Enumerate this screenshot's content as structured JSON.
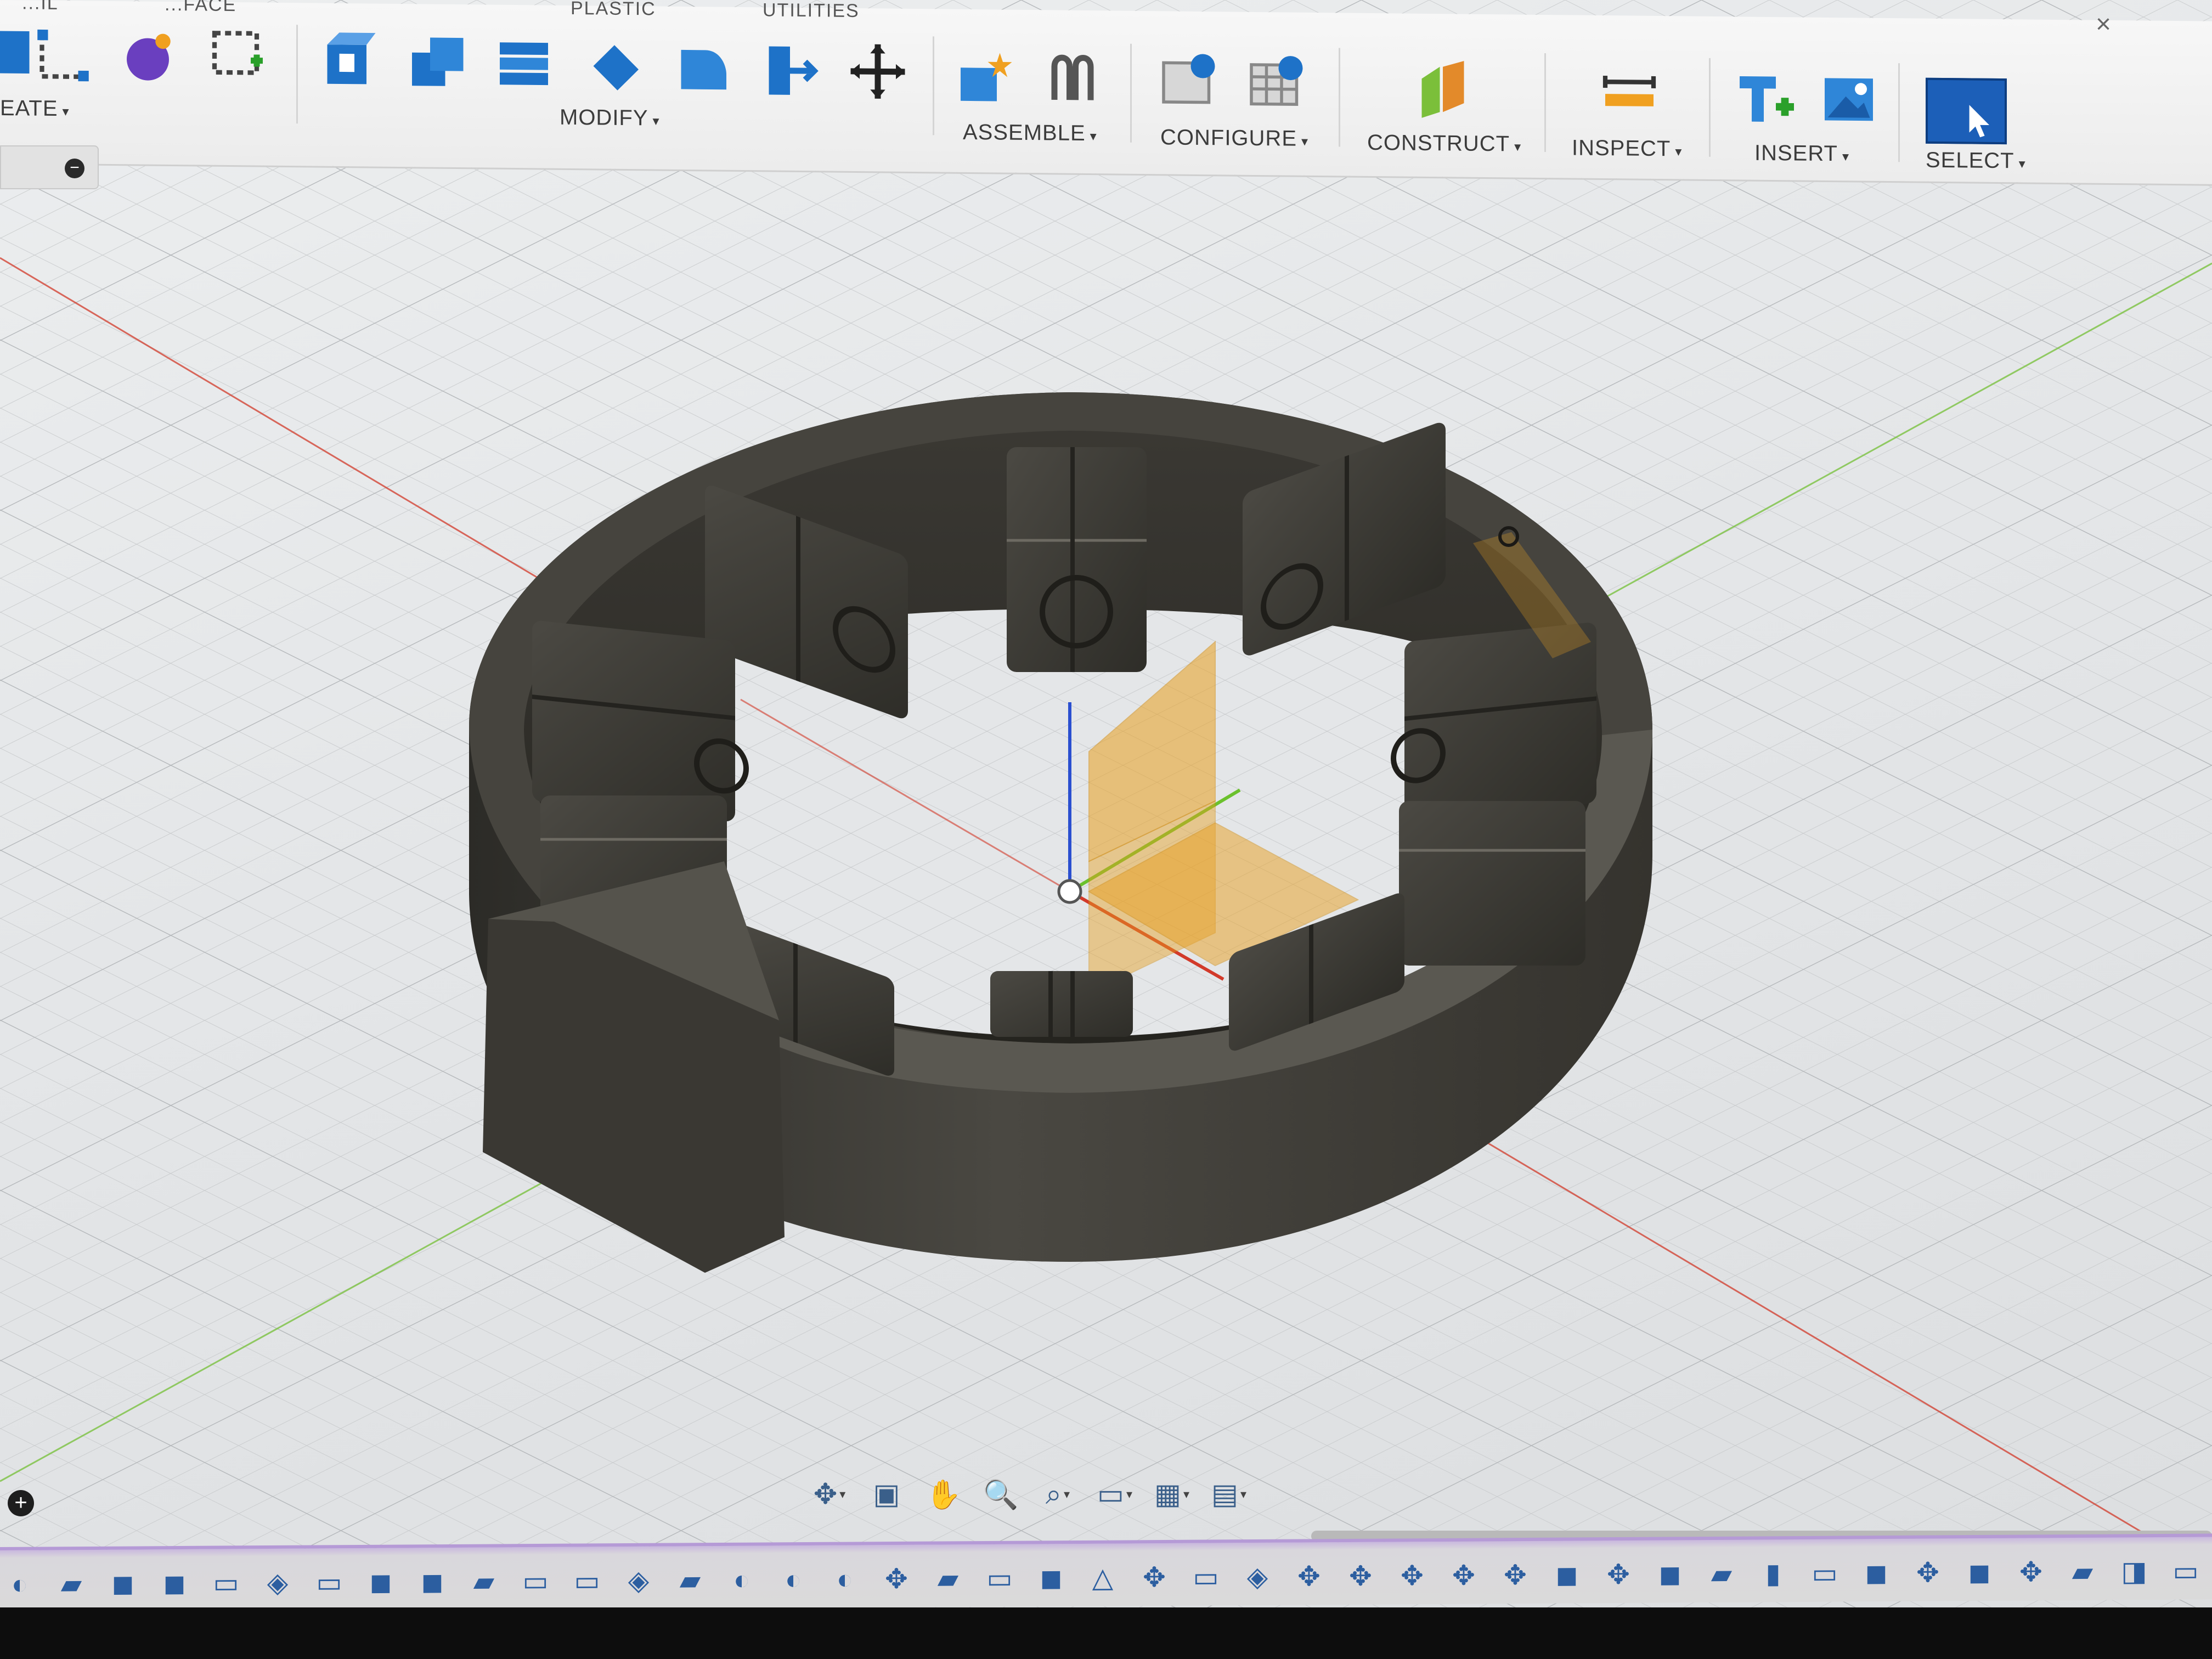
{
  "toolbar": {
    "tabs": [
      {
        "name": "solid",
        "label": "...IL"
      },
      {
        "name": "surface",
        "label": "...FACE"
      },
      {
        "name": "plastic",
        "label": "PLASTIC"
      },
      {
        "name": "utilities",
        "label": "UTILITIES"
      }
    ],
    "groups": {
      "create": "EATE",
      "modify": "MODIFY",
      "assemble": "ASSEMBLE",
      "configure": "CONFIGURE",
      "construct": "CONSTRUCT",
      "inspect": "INSPECT",
      "insert": "INSERT",
      "select": "SELECT"
    },
    "caret": "▾",
    "close_glyph": "×"
  },
  "browser": {
    "collapse_glyph": "−"
  },
  "viewport": {
    "accent": "#e8a020",
    "model_color": "#3d3b36",
    "axis_colors": {
      "x": "#d23a2a",
      "y": "#5fb82c",
      "z": "#2a4fd0"
    },
    "slot_count": 10
  },
  "navbar": {
    "items": [
      {
        "name": "orbit-icon",
        "glyph": "✥",
        "caret": "▾"
      },
      {
        "name": "look-at-icon",
        "glyph": "▣",
        "caret": ""
      },
      {
        "name": "pan-icon",
        "glyph": "✋",
        "caret": ""
      },
      {
        "name": "zoom-icon",
        "glyph": "🔍",
        "caret": ""
      },
      {
        "name": "zoom-window-icon",
        "glyph": "⌕",
        "caret": "▾"
      },
      {
        "name": "display-settings-icon",
        "glyph": "▭",
        "caret": "▾"
      },
      {
        "name": "grid-settings-icon",
        "glyph": "▦",
        "caret": "▾"
      },
      {
        "name": "viewports-icon",
        "glyph": "▤",
        "caret": "▾"
      }
    ]
  },
  "bottom": {
    "add_glyph": "+"
  },
  "timeline": {
    "items": [
      "◐",
      "▰",
      "◼",
      "◼",
      "▭",
      "◈",
      "▭",
      "◼",
      "◼",
      "▰",
      "▭",
      "▭",
      "◈",
      "▰",
      "◐",
      "◐",
      "◐",
      "✥",
      "▰",
      "▭",
      "◼",
      "△",
      "✥",
      "▭",
      "◈",
      "✥",
      "✥",
      "✥",
      "✥",
      "✥",
      "◼",
      "✥",
      "◼",
      "▰",
      "▮",
      "▭",
      "◼",
      "✥",
      "◼",
      "✥",
      "▰",
      "◨",
      "▭",
      "◈"
    ]
  }
}
